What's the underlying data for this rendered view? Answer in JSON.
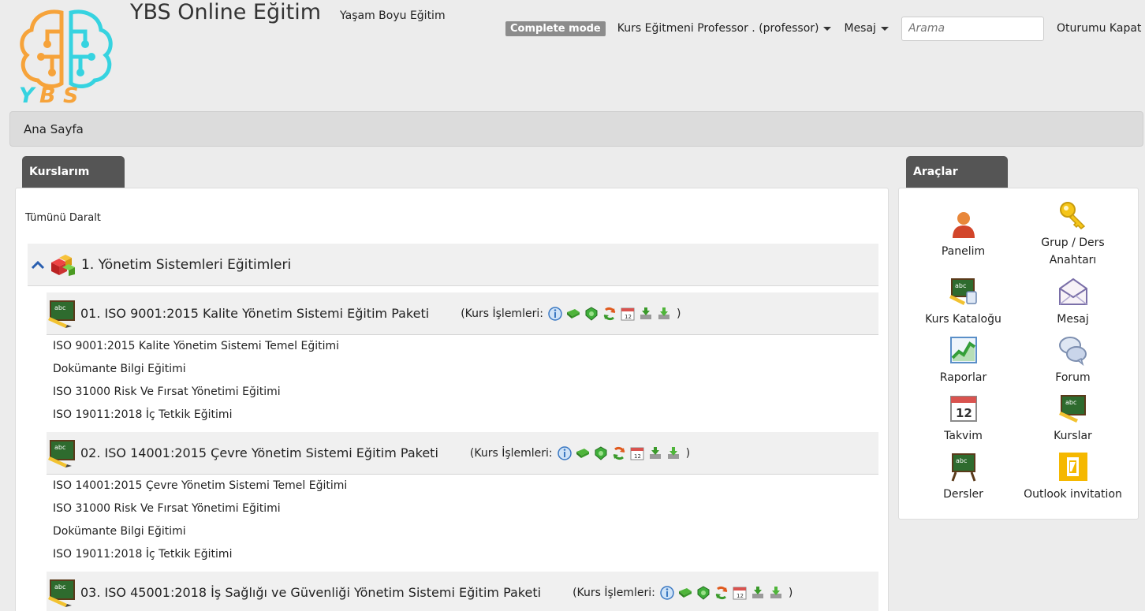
{
  "header": {
    "site_title": "YBS Online Eğitim",
    "site_subtitle": "Yaşam Boyu Eğitim",
    "logo_text": "YBS",
    "mode_badge": "Complete mode",
    "user_menu": "Kurs Eğitmeni Professor . (professor)",
    "message_menu": "Mesaj",
    "search_placeholder": "Arama",
    "logout": "Oturumu Kapat"
  },
  "breadcrumb": {
    "home": "Ana Sayfa"
  },
  "courses": {
    "tab_label": "Kurslarım",
    "collapse_all": "Tümünü Daralt",
    "category": {
      "title": "1. Yönetim Sistemleri Eğitimleri"
    },
    "ops_label": "(Kurs İşlemleri:",
    "ops_close": ")",
    "packages": [
      {
        "title": "01. ISO 9001:2015 Kalite Yönetim Sistemi Eğitim Paketi",
        "lessons": [
          "ISO 9001:2015 Kalite Yönetim Sistemi Temel Eğitimi",
          "Dokümante Bilgi Eğitimi",
          "ISO 31000 Risk Ve Fırsat Yönetimi Eğitimi",
          "ISO 19011:2018 İç Tetkik Eğitimi"
        ]
      },
      {
        "title": "02. ISO 14001:2015 Çevre Yönetim Sistemi Eğitim Paketi",
        "lessons": [
          "ISO 14001:2015 Çevre Yönetim Sistemi Temel Eğitimi",
          "ISO 31000 Risk Ve Fırsat Yönetimi Eğitimi",
          "Dokümante Bilgi Eğitimi",
          "ISO 19011:2018 İç Tetkik Eğitimi"
        ]
      },
      {
        "title": "03. ISO 45001:2018 İş Sağlığı ve Güvenliği Yönetim Sistemi Eğitim Paketi",
        "lessons": []
      }
    ]
  },
  "tools": {
    "tab_label": "Araçlar",
    "items": [
      {
        "label": "Panelim",
        "icon": "user-icon"
      },
      {
        "label": "Grup / Ders Anahtarı",
        "icon": "key-icon"
      },
      {
        "label": "Kurs Kataloğu",
        "icon": "catalog-icon"
      },
      {
        "label": "Mesaj",
        "icon": "envelope-icon"
      },
      {
        "label": "Raporlar",
        "icon": "chart-icon"
      },
      {
        "label": "Forum",
        "icon": "speech-bubbles-icon"
      },
      {
        "label": "Takvim",
        "icon": "calendar-icon",
        "badge": "12"
      },
      {
        "label": "Kurslar",
        "icon": "chalkboard-icon"
      },
      {
        "label": "Dersler",
        "icon": "lesson-board-icon"
      },
      {
        "label": "Outlook invitation",
        "icon": "outlook-icon"
      }
    ]
  },
  "colors": {
    "tab_bg": "#555555",
    "breadcrumb_bg": "#dcdcdc",
    "logo_orange": "#f6a33a",
    "logo_cyan": "#36d3e0",
    "board_green": "#2e6b2e"
  }
}
